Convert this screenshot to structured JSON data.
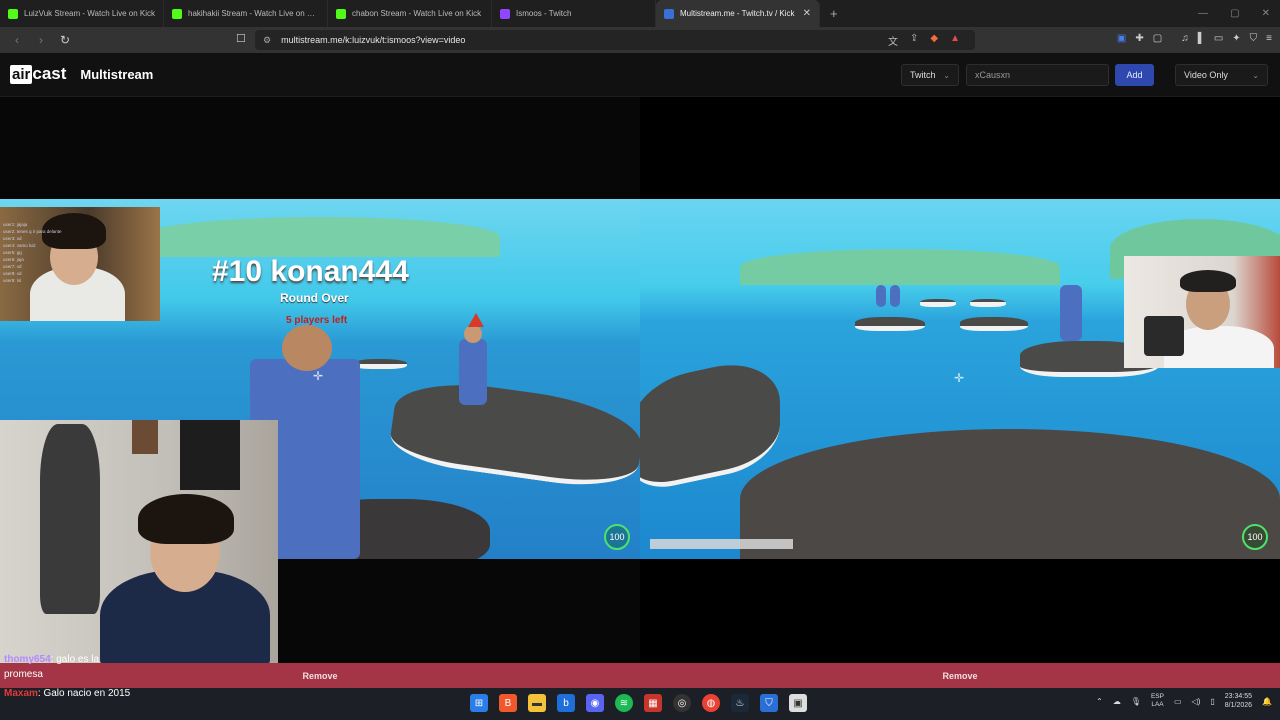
{
  "browser": {
    "tabs": [
      {
        "title": "LuizVuk Stream - Watch Live on Kick",
        "color": "#53fc18",
        "active": false
      },
      {
        "title": "hakihakii Stream - Watch Live on Kick",
        "color": "#53fc18",
        "active": false
      },
      {
        "title": "chabon Stream - Watch Live on Kick",
        "color": "#53fc18",
        "active": false
      },
      {
        "title": "Ismoos - Twitch",
        "color": "#9146ff",
        "active": false
      },
      {
        "title": "Multistream.me - Twitch.tv / Kick",
        "color": "#3b6fd8",
        "active": true
      }
    ],
    "new_tab": "+",
    "url": "multistream.me/k:luizvuk/t:ismoos?view=video",
    "window_controls": [
      "—",
      "▢",
      "✕"
    ]
  },
  "app": {
    "logo_air": "air",
    "logo_cast": "cast",
    "title": "Multistream",
    "platform_select": "Twitch",
    "channel_input_value": "xCausxn",
    "add_label": "Add",
    "view_select": "Video Only"
  },
  "streams": [
    {
      "overlay_title": "#10 konan444",
      "round_over": "Round Over",
      "status_left": "5 players left",
      "timer": "100",
      "remove_label": "Remove",
      "chat_lines": [
        "user1: jajaja",
        "user2: tenes q ir para delante",
        "user3: xd",
        "user4: vamo luiz",
        "user5: gg",
        "user6: jaja",
        "user7: xd",
        "user8: xd",
        "user9: lol"
      ]
    },
    {
      "timer": "100",
      "remove_label": "Remove"
    }
  ],
  "chat_ticker": {
    "line1_user": "thomy654",
    "line1_text": ": galo es la",
    "line2_text": "promesa",
    "line3_user": "Maxam",
    "line3_text": ": Galo nacio en 2015"
  },
  "taskbar": {
    "icons": [
      "windows-icon",
      "brave-icon",
      "folder-icon",
      "bing-icon",
      "discord-icon",
      "spotify-icon",
      "calendar-icon",
      "obs-icon",
      "chrome-icon",
      "steam-icon",
      "shield-icon",
      "app-icon"
    ],
    "lang_top": "ESP",
    "lang_bottom": "LAA",
    "time": "23:34:55",
    "date": "8/1/2026"
  }
}
